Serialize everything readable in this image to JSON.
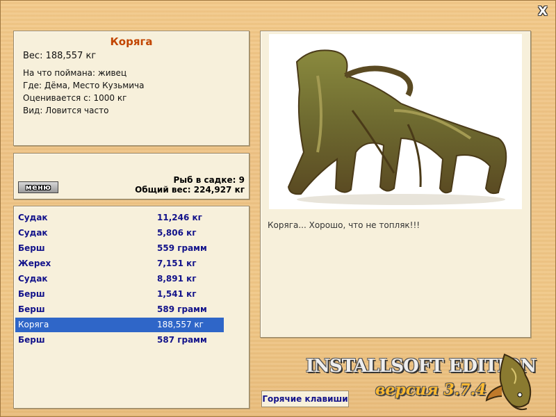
{
  "window": {
    "close_label": "X"
  },
  "fish": {
    "title": "Коряга",
    "weight": "Вес: 188,557 кг",
    "details": [
      "На что поймана: живец",
      "Где: Дёма, Место Кузьмича",
      "Оценивается с: 1000 кг",
      "Вид: Ловится часто"
    ],
    "caption": "Коряга... Хорошо, что не топляк!!!",
    "image_icon": "driftwood-image"
  },
  "summary": {
    "menu_label": "меню",
    "count": "Рыб в садке: 9",
    "total": "Общий вес: 224,927 кг"
  },
  "catches": [
    {
      "name": "Судак",
      "weight": "11,246 кг"
    },
    {
      "name": "Судак",
      "weight": "5,806 кг"
    },
    {
      "name": "Берш",
      "weight": "559 грамм"
    },
    {
      "name": "Жерех",
      "weight": "7,151 кг"
    },
    {
      "name": "Судак",
      "weight": "8,891 кг"
    },
    {
      "name": "Берш",
      "weight": "1,541 кг"
    },
    {
      "name": "Берш",
      "weight": "589 грамм"
    },
    {
      "name": "Коряга",
      "weight": "188,557 кг",
      "selected": true
    },
    {
      "name": "Берш",
      "weight": "587 грамм"
    }
  ],
  "footer": {
    "hotkeys_label": "Горячие клавиши",
    "brand": "INSTALLSOFT EDITION",
    "version": "версия 3.7.4",
    "logo_icon": "pike-fish-logo"
  },
  "colors": {
    "accent": "#c24500",
    "list_text": "#12128a",
    "selection": "#2f66c8"
  }
}
